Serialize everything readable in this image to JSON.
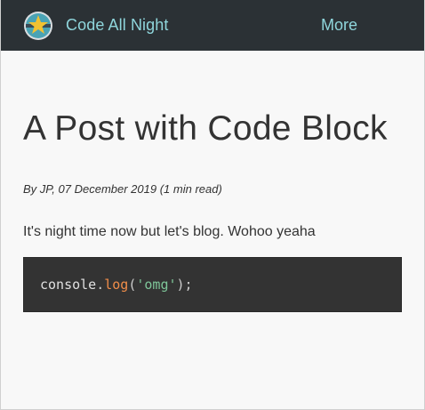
{
  "header": {
    "site_name": "Code All Night",
    "nav_more": "More",
    "logo_icon": "night-star-logo-icon",
    "colors": {
      "bar_bg": "#2b3135",
      "link": "#8fd6dc",
      "logo_circle": "#4aa3b5",
      "logo_star": "#f1c232"
    }
  },
  "post": {
    "title": "A Post with Code Block",
    "meta": {
      "prefix": "By ",
      "author": "JP",
      "date_sep": ", ",
      "date": "07 December 2019",
      "read_time": " (1 min read)"
    },
    "paragraph": "It's night time now but let's blog. Wohoo yeaha",
    "code": {
      "object": "console",
      "dot": ".",
      "method": "log",
      "open_paren": "(",
      "argument": "'omg'",
      "close": ");"
    }
  }
}
